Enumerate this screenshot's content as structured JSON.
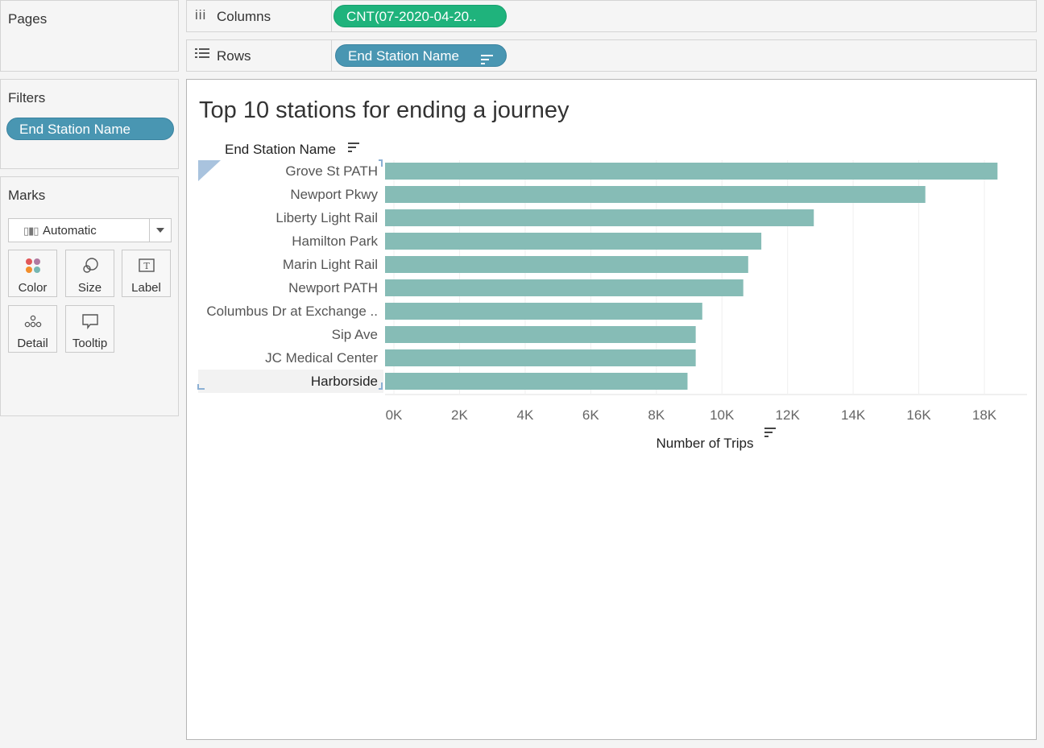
{
  "pages": {
    "title": "Pages"
  },
  "filters": {
    "title": "Filters",
    "items": [
      {
        "label": "End Station Name"
      }
    ]
  },
  "marks": {
    "title": "Marks",
    "mark_type": "Automatic",
    "buttons": [
      {
        "label": "Color",
        "icon": "color-icon"
      },
      {
        "label": "Size",
        "icon": "size-icon"
      },
      {
        "label": "Label",
        "icon": "label-icon"
      },
      {
        "label": "Detail",
        "icon": "detail-icon"
      },
      {
        "label": "Tooltip",
        "icon": "tooltip-icon"
      }
    ]
  },
  "shelves": {
    "columns": {
      "label": "Columns",
      "pill": "CNT(07-2020-04-20.."
    },
    "rows": {
      "label": "Rows",
      "pill": "End Station Name"
    }
  },
  "colors": {
    "bar": "#86bcb6",
    "pill_blue": "#4996b2",
    "pill_green": "#1fb37c"
  },
  "chart_data": {
    "type": "bar",
    "orientation": "horizontal",
    "title": "Top 10 stations for ending a journey",
    "row_header": "End Station Name",
    "xlabel": "Number of Trips",
    "categories": [
      "Grove St PATH",
      "Newport Pkwy",
      "Liberty Light Rail",
      "Hamilton Park",
      "Marin Light Rail",
      "Newport PATH",
      "Columbus Dr at Exchange ..",
      "Sip Ave",
      "JC Medical Center",
      "Harborside"
    ],
    "values": [
      18400,
      16200,
      12800,
      11200,
      10800,
      10650,
      9400,
      9200,
      9200,
      8950
    ],
    "xlim": [
      0,
      19000
    ],
    "xticks": [
      0,
      2000,
      4000,
      6000,
      8000,
      10000,
      12000,
      14000,
      16000,
      18000
    ],
    "xtick_labels": [
      "0K",
      "2K",
      "4K",
      "6K",
      "8K",
      "10K",
      "12K",
      "14K",
      "16K",
      "18K"
    ],
    "grid": true,
    "legend": "none"
  }
}
